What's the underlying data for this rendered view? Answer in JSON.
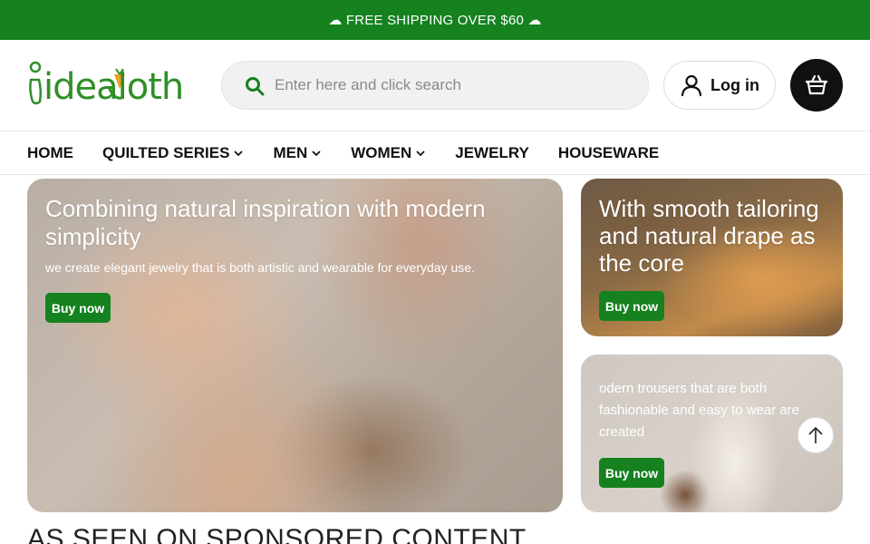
{
  "announcement": {
    "text": "☁ FREE SHIPPING OVER $60 ☁"
  },
  "brand": {
    "logo_text": "idealoth",
    "logo_alt": "idealcloth"
  },
  "search": {
    "placeholder": "Enter here and click search",
    "value": ""
  },
  "header": {
    "login_label": "Log in",
    "cart_icon": "basket-icon",
    "user_icon": "user-icon"
  },
  "nav": {
    "items": [
      {
        "label": "HOME",
        "has_dropdown": false
      },
      {
        "label": "QUILTED SERIES",
        "has_dropdown": true
      },
      {
        "label": "MEN",
        "has_dropdown": true
      },
      {
        "label": "WOMEN",
        "has_dropdown": true
      },
      {
        "label": "JEWELRY",
        "has_dropdown": false
      },
      {
        "label": "HOUSEWARE",
        "has_dropdown": false
      }
    ]
  },
  "banners": {
    "main": {
      "title": "Combining natural inspiration with modern simplicity",
      "subtitle": "we create elegant jewelry that is both artistic and wearable for everyday use.",
      "button": "Buy now"
    },
    "top_right": {
      "title": "With smooth tailoring and natural drape as the core",
      "button": "Buy now"
    },
    "bottom_right": {
      "subtitle": "odern trousers that are both fashionable and easy to wear are created",
      "button": "Buy now"
    }
  },
  "section": {
    "title": "AS SEEN ON SPONSORED CONTENT"
  },
  "colors": {
    "brand_green": "#15811f",
    "logo_green": "#2f8f27",
    "dark": "#111111"
  }
}
